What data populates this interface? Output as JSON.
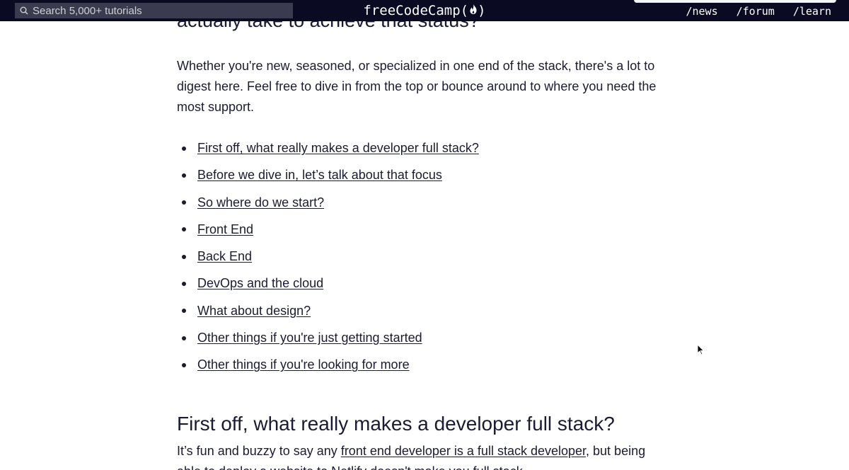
{
  "nav": {
    "search_placeholder": "Search 5,000+ tutorials",
    "logo_text": "freeCodeCamp(",
    "logo_close": ")",
    "links": [
      "/news",
      "/forum",
      "/learn"
    ]
  },
  "article": {
    "clipped_heading": "actually take to achieve that status?",
    "intro": "Whether you're new, seasoned, or specialized in one end of the stack, there's a lot to digest here. Feel free to dive in from the top or bounce around to where you need the most support.",
    "toc": [
      "First off, what really makes a developer full stack?",
      "Before we dive in, let’s talk about that focus",
      "So where do we start?",
      "Front End",
      "Back End",
      "DevOps and the cloud",
      "What about design?",
      "Other things if you're just getting started",
      "Other things if you're looking for more"
    ],
    "section_heading": "First off, what really makes a developer full stack?",
    "section_para_before": "It’s fun and buzzy to say any ",
    "section_para_link": "front end developer is a full stack developer",
    "section_para_after": ", but being able to deploy a website to Netlify doesn't make you full stack."
  },
  "colors": {
    "nav_bg": "#0a0a23",
    "search_bg": "#3b3b4f",
    "text": "#1b1b32"
  },
  "icons": [
    "search-icon",
    "flame-icon",
    "mouse-cursor-icon"
  ]
}
